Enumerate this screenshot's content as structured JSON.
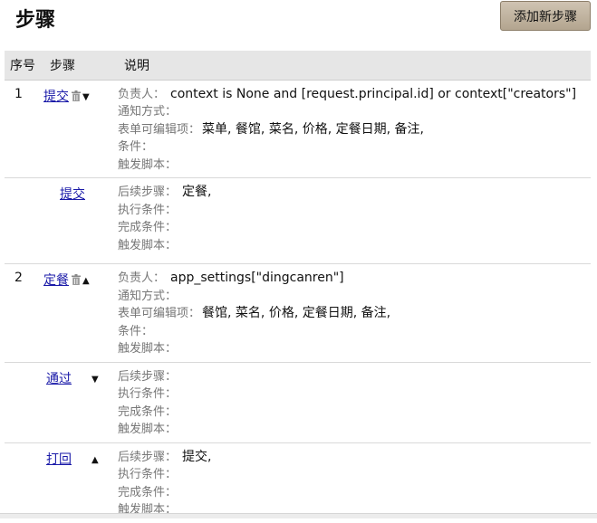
{
  "header": {
    "title": "步骤",
    "add_button": "添加新步骤"
  },
  "table": {
    "columns": [
      "序号",
      "步骤",
      "说明"
    ]
  },
  "labels": {
    "owner": "负责人：",
    "notify": "通知方式：",
    "editable": "表单可编辑项：",
    "condition": "条件：",
    "script": "触发脚本：",
    "next": "后续步骤：",
    "exec_cond": "执行条件：",
    "done_cond": "完成条件："
  },
  "rows": [
    {
      "seq": "1",
      "step": "提交",
      "owner": "context is None and [request.principal.id] or context[\"creators\"]",
      "editable": "菜单, 餐馆, 菜名, 价格, 定餐日期, 备注,"
    },
    {
      "step": "提交",
      "next": "定餐,"
    },
    {
      "seq": "2",
      "step": "定餐",
      "owner": "app_settings[\"dingcanren\"]",
      "editable": "餐馆, 菜名, 价格, 定餐日期, 备注,"
    },
    {
      "step": "通过",
      "next": ""
    },
    {
      "step": "打回",
      "next": "提交,"
    }
  ]
}
